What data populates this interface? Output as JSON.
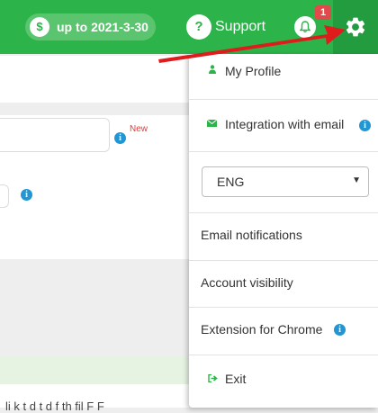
{
  "header": {
    "plan_label": "up to 2021-3-30",
    "plan_icon": "$",
    "support_icon": "?",
    "support_label": "Support",
    "notification_count": "1"
  },
  "page": {
    "new_badge": "New",
    "bottom_text": "li k t   d t d f   th   fil         F      F"
  },
  "menu": {
    "my_profile": "My Profile",
    "integration_email": "Integration with email",
    "language_value": "ENG",
    "email_notifications": "Email notifications",
    "account_visibility": "Account visibility",
    "extension_chrome": "Extension for Chrome",
    "exit": "Exit",
    "info_glyph": "i"
  },
  "colors": {
    "brand_green": "#2cb34a",
    "gear_bg": "#229c3e",
    "badge_red": "#e04a4a",
    "info_blue": "#2196d3",
    "annotation_arrow": "#e01b1b"
  }
}
